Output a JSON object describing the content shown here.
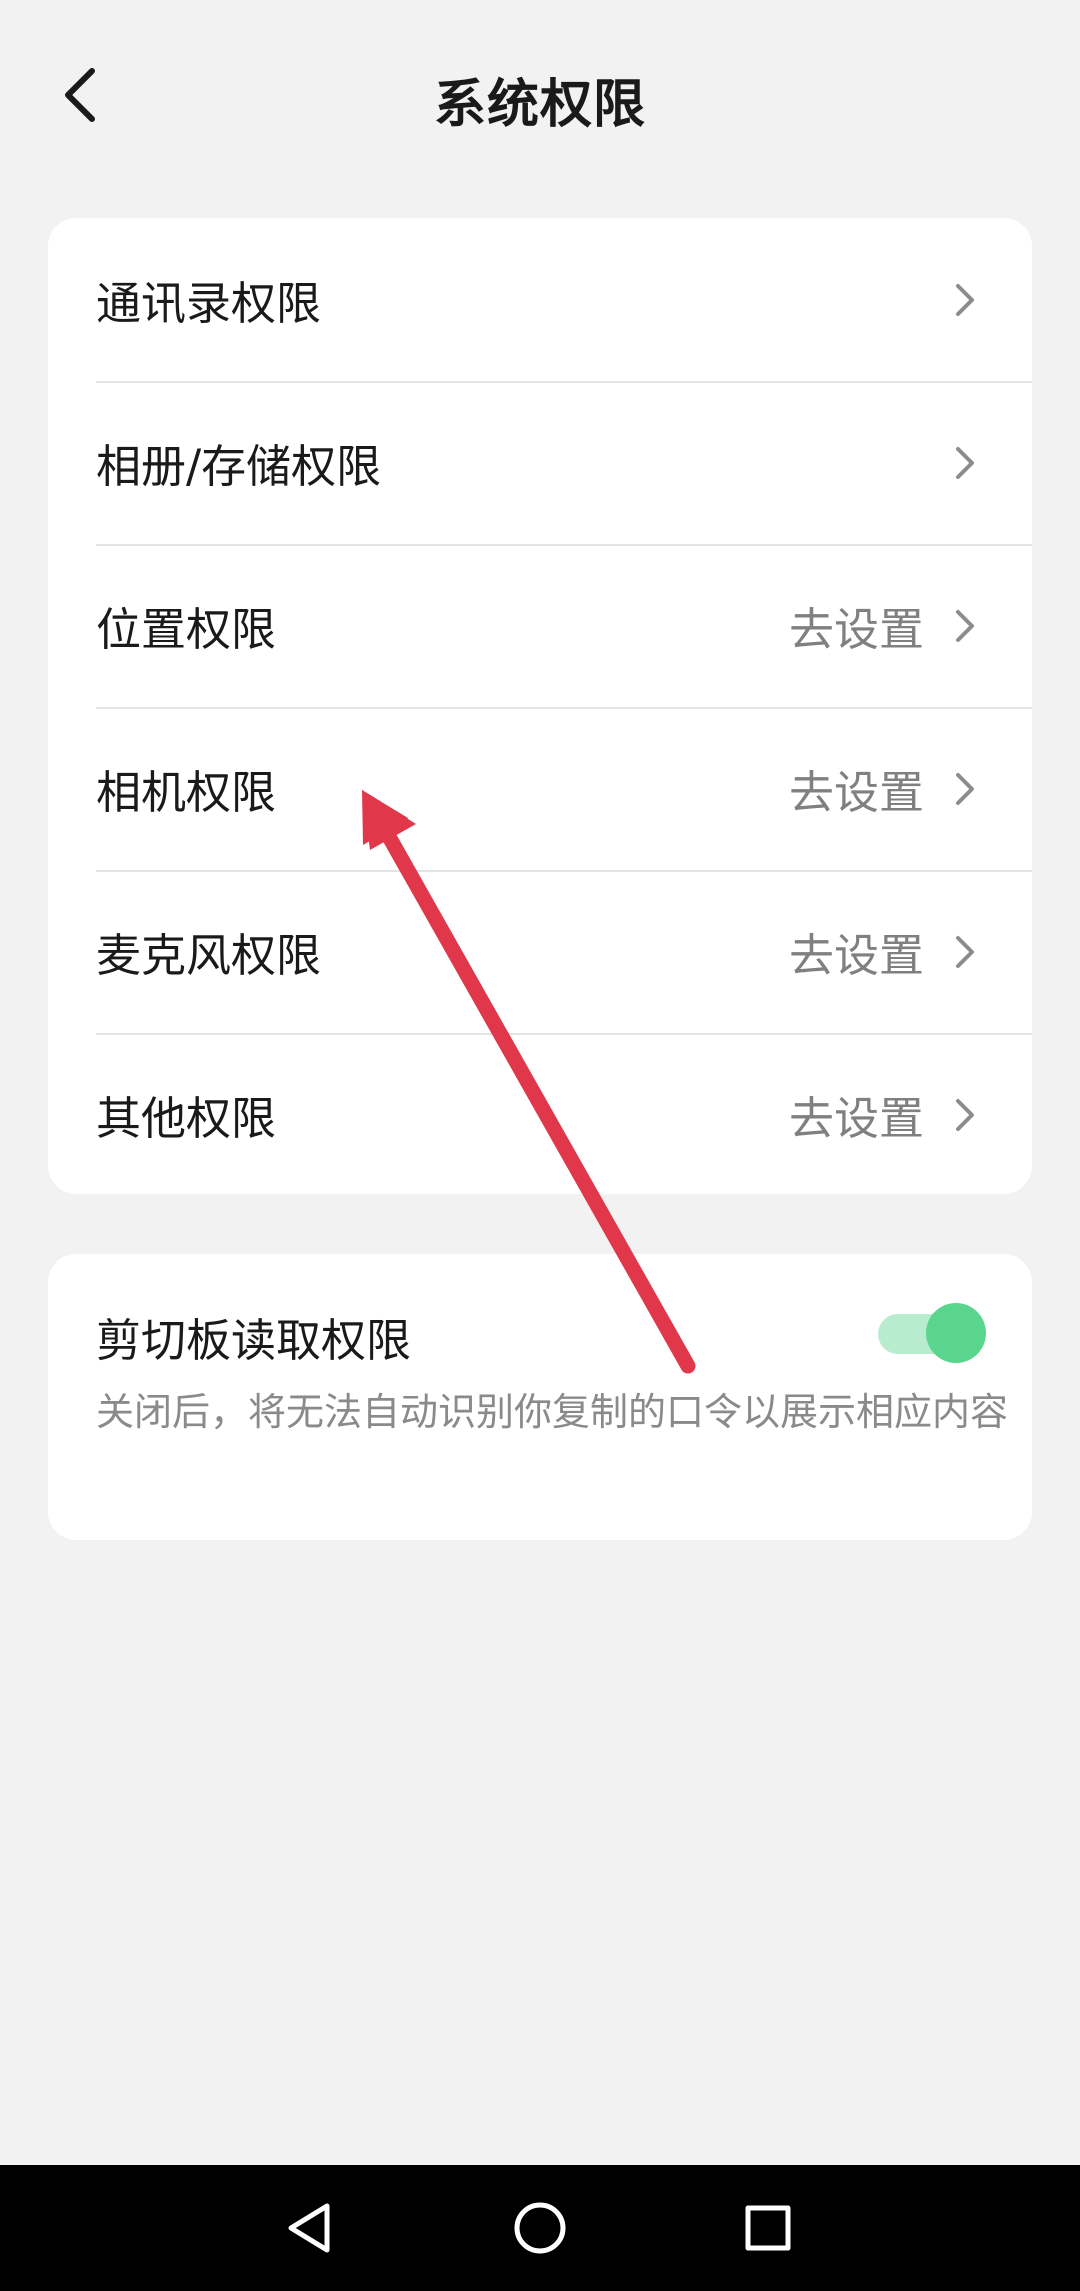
{
  "header": {
    "title": "系统权限"
  },
  "permissions": [
    {
      "label": "通讯录权限",
      "action": ""
    },
    {
      "label": "相册/存储权限",
      "action": ""
    },
    {
      "label": "位置权限",
      "action": "去设置"
    },
    {
      "label": "相机权限",
      "action": "去设置"
    },
    {
      "label": "麦克风权限",
      "action": "去设置"
    },
    {
      "label": "其他权限",
      "action": "去设置"
    }
  ],
  "clipboard": {
    "title": "剪切板读取权限",
    "description": "关闭后，将无法自动识别你复制的口令以展示相应内容",
    "enabled": true
  },
  "colors": {
    "background": "#f2f2f2",
    "toggle_on": "#5ad58e",
    "annotation_arrow": "#e0384a"
  },
  "icons": {
    "back": "chevron-left-icon",
    "row_chevron": "chevron-right-icon",
    "nav_back": "triangle-back-icon",
    "nav_home": "circle-home-icon",
    "nav_recents": "square-recents-icon"
  }
}
